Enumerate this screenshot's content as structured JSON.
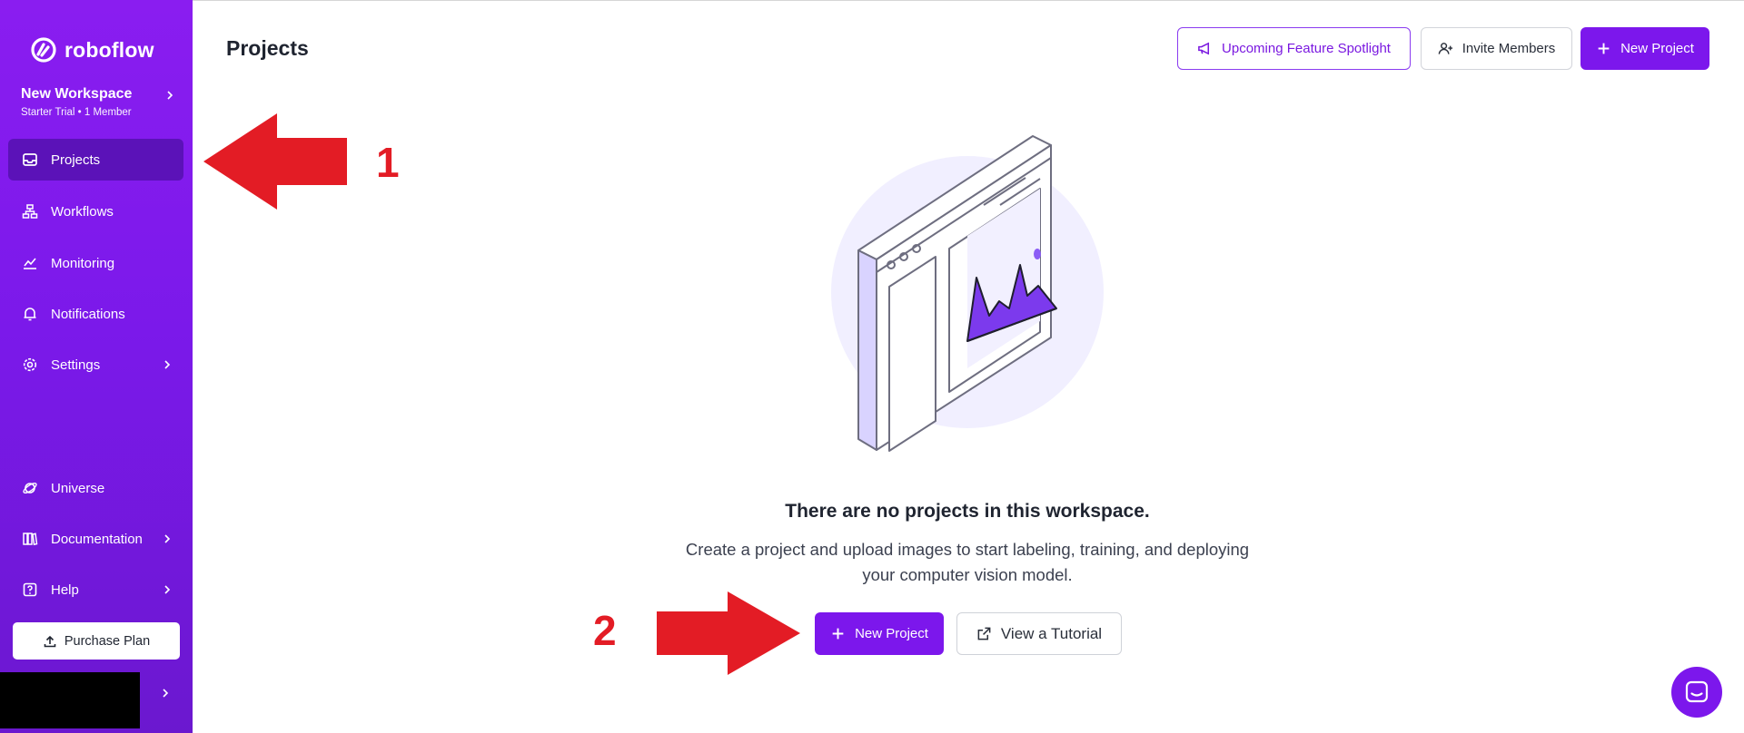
{
  "app": {
    "brand": "roboflow",
    "accent_color": "#7c17ec"
  },
  "workspace": {
    "name": "New Workspace",
    "plan": "Starter Trial",
    "members": "1 Member"
  },
  "sidebar": {
    "items": [
      {
        "label": "Projects",
        "icon": "inbox-icon",
        "active": true
      },
      {
        "label": "Workflows",
        "icon": "workflow-icon"
      },
      {
        "label": "Monitoring",
        "icon": "chart-icon"
      },
      {
        "label": "Notifications",
        "icon": "bell-icon"
      },
      {
        "label": "Settings",
        "icon": "gear-icon",
        "has_submenu": true
      },
      {
        "label": "Universe",
        "icon": "planet-icon"
      },
      {
        "label": "Documentation",
        "icon": "book-icon",
        "has_submenu": true
      },
      {
        "label": "Help",
        "icon": "help-icon",
        "has_submenu": true
      }
    ],
    "purchase_label": "Purchase Plan"
  },
  "header": {
    "title": "Projects",
    "spotlight_label": "Upcoming Feature Spotlight",
    "invite_label": "Invite Members",
    "new_project_label": "New Project"
  },
  "empty_state": {
    "title": "There are no projects in this workspace.",
    "description_line1": "Create a project and upload images to start labeling, training, and deploying",
    "description_line2": "your computer vision model.",
    "new_project_label": "New Project",
    "tutorial_label": "View a Tutorial"
  },
  "annotations": {
    "label_1": "1",
    "label_2": "2",
    "color": "#e31c25"
  }
}
